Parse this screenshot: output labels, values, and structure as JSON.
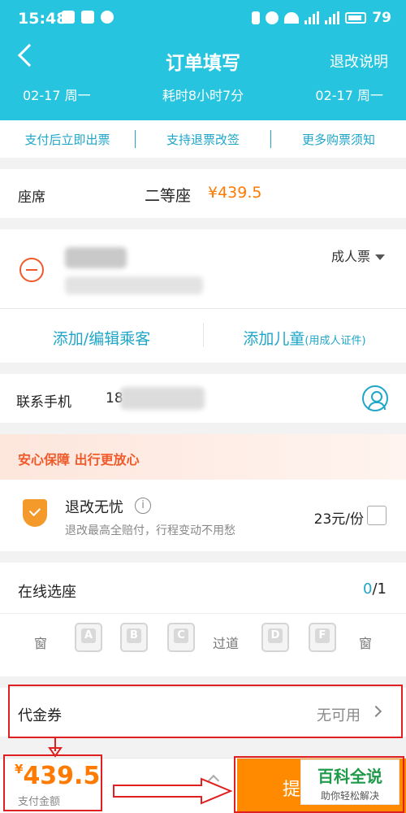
{
  "status": {
    "time": "15:48",
    "battery": "79",
    "net1": "4G",
    "net2": "3G"
  },
  "header": {
    "title": "订单填写",
    "refund_link": "退改说明",
    "date_left": "02-17 周一",
    "duration": "耗时8小时7分",
    "date_right": "02-17 周一"
  },
  "features": [
    "支付后立即出票",
    "支持退票改签",
    "更多购票须知"
  ],
  "seat": {
    "label": "座席",
    "class": "二等座",
    "price": "¥439.5"
  },
  "passenger": {
    "ticket_type": "成人票",
    "add_edit": "添加/编辑乘客",
    "add_child": "添加儿童",
    "add_child_note": "(用成人证件)"
  },
  "contact": {
    "label": "联系手机",
    "phone_prefix": "18"
  },
  "insurance": {
    "title": "安心保障 出行更放心",
    "name": "退改无忧",
    "info": "i",
    "desc": "退改最高全赔付，行程变动不用愁",
    "price": "23元/份"
  },
  "seat_select": {
    "title": "在线选座",
    "selected": "0",
    "total": "/1",
    "window": "窗",
    "aisle": "过道",
    "seats": [
      "A",
      "B",
      "C",
      "D",
      "F"
    ]
  },
  "voucher": {
    "label": "代金券",
    "value": "无可用"
  },
  "bottom": {
    "currency": "¥",
    "amount": "439.5",
    "label": "支付金额",
    "submit": "提"
  },
  "watermark": {
    "main": "百科全说",
    "sub": "助你轻松解决"
  },
  "colors": {
    "header": "#26c4de",
    "accent": "#1fa6c8",
    "price": "#ff7a00",
    "submit": "#ff8a00",
    "annotation": "#e02020"
  }
}
